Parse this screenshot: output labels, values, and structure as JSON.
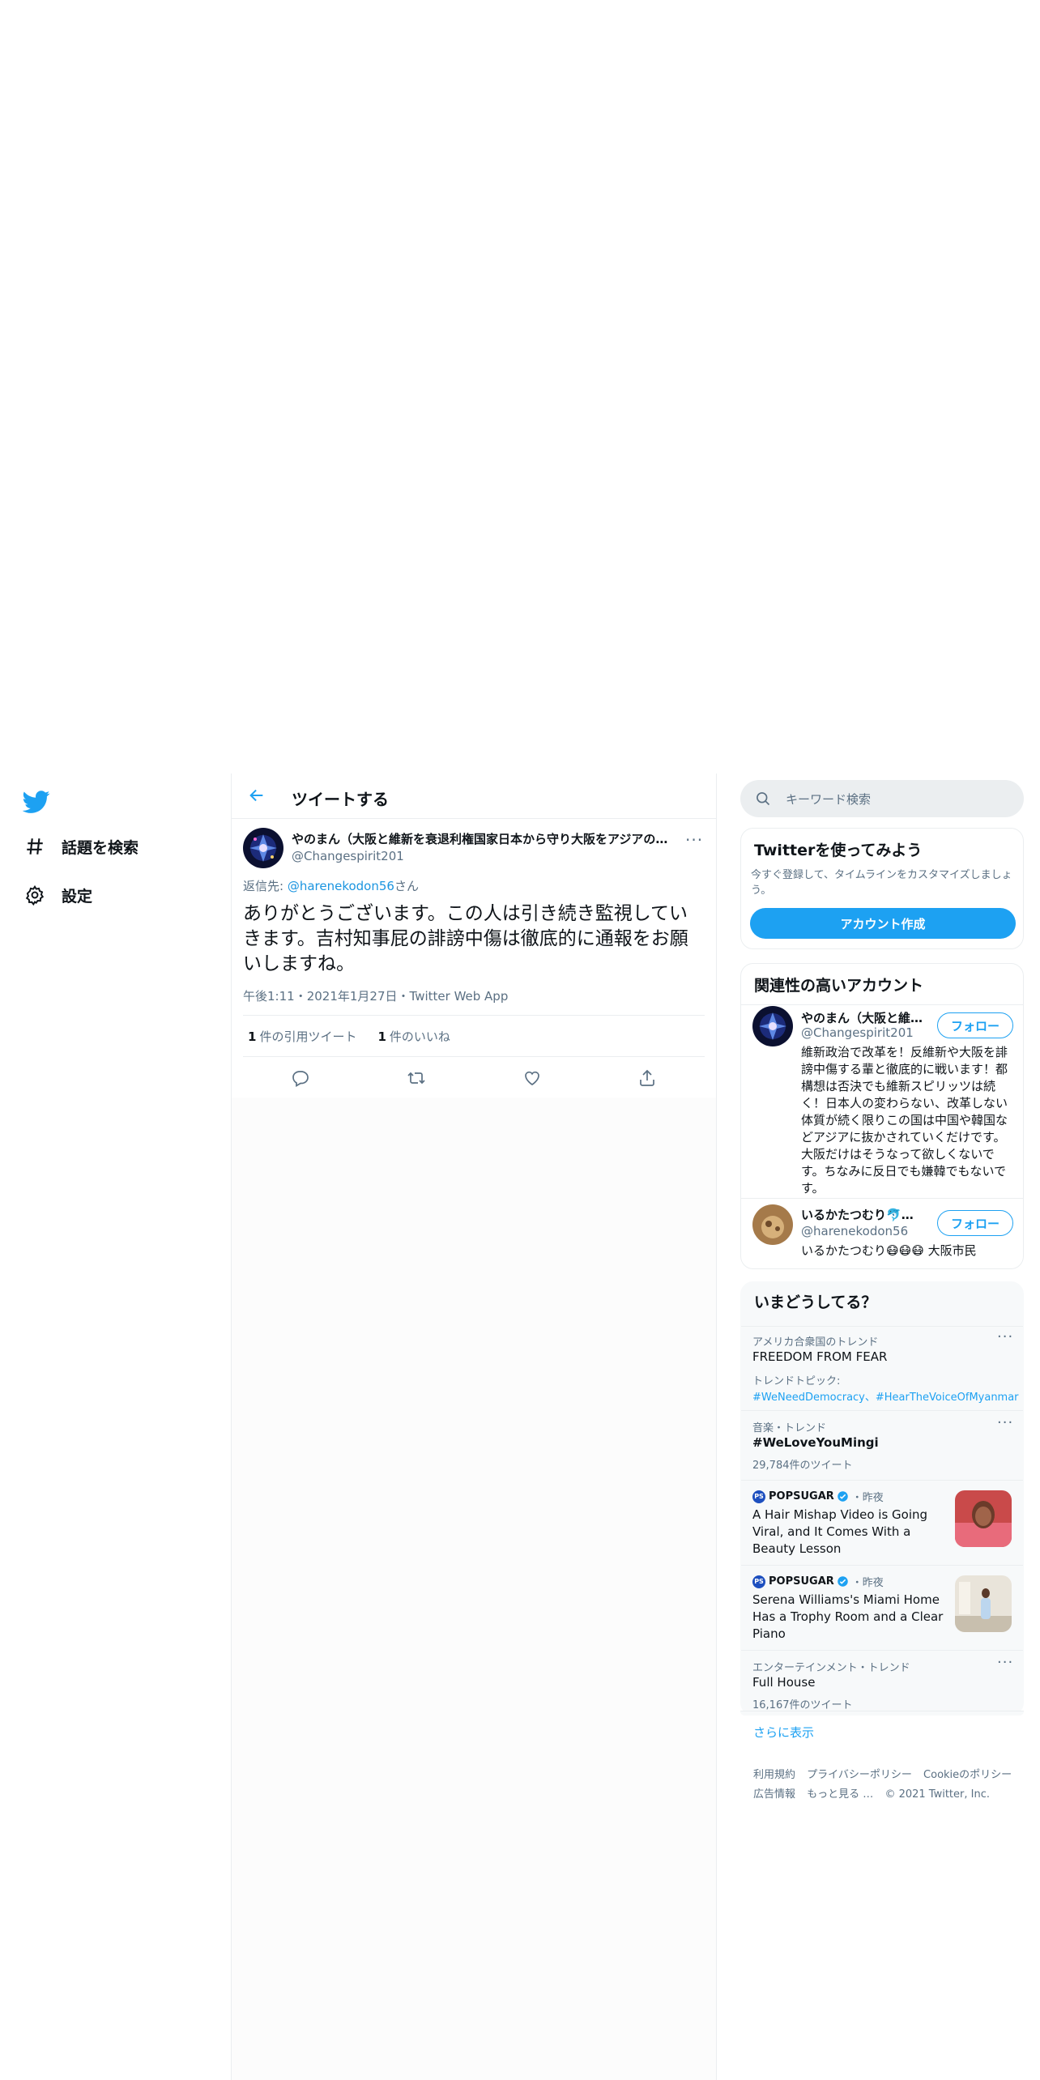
{
  "nav": {
    "logo_icon": "twitter-bird-icon",
    "items": [
      {
        "icon": "hashtag-icon",
        "label": "話題を検索"
      },
      {
        "icon": "gear-icon",
        "label": "設定"
      }
    ]
  },
  "header": {
    "back_icon": "arrow-left-icon",
    "title": "ツイートする"
  },
  "tweet": {
    "author_name": "やのまん（大阪と維新を衰退利権国家日本から守り大阪をアジアの…",
    "author_handle": "@Changespirit201",
    "more_icon": "more-icon",
    "reply_prefix": "返信先: ",
    "reply_handle": "@harenekodon56",
    "reply_suffix": "さん",
    "text": "ありがとうございます。この人は引き続き監視していきます。吉村知事屁の誹謗中傷は徹底的に通報をお願いしますね。",
    "time": "午後1:11",
    "date": "2021年1月27日",
    "source": "Twitter Web App",
    "sep": "・",
    "quote_count": "1",
    "quote_label": "件の引用ツイート",
    "like_count": "1",
    "like_label": "件のいいね",
    "actions": [
      "reply-icon",
      "retweet-icon",
      "like-icon",
      "share-icon"
    ]
  },
  "search": {
    "placeholder": "キーワード検索",
    "icon": "search-icon"
  },
  "signup": {
    "title": "Twitterを使ってみよう",
    "desc": "今すぐ登録して、タイムラインをカスタマイズしましょう。",
    "button": "アカウント作成"
  },
  "related": {
    "title": "関連性の高いアカウント",
    "accounts": [
      {
        "name": "やのまん（大阪と維…",
        "handle": "@Changespirit201",
        "follow": "フォロー",
        "bio": "維新政治で改革を！反維新や大阪を誹謗中傷する輩と徹底的に戦います！都構想は否決でも維新スピリッツは続く！日本人の変わらない、改革しない体質が続く限りこの国は中国や韓国などアジアに抜かされていくだけです。大阪だけはそうなって欲しくないです。ちなみに反日でも嫌韓でもないです。"
      },
      {
        "name": "いるかたつむり🐬🐌🐮",
        "handle": "@harenekodon56",
        "follow": "フォロー",
        "bio": "いるかたつむり😷😷😷 大阪市民"
      }
    ]
  },
  "trends": {
    "title": "いまどうしてる？",
    "items": [
      {
        "context": "アメリカ合衆国のトレンド",
        "title": "FREEDOM FROM FEAR",
        "topic_label": "トレンドトピック:",
        "topics": "#WeNeedDemocracy、#HearTheVoiceOfMyanmar"
      },
      {
        "context": "音楽・トレンド",
        "title": "#WeLoveYouMingi",
        "count": "29,784件のツイート"
      },
      {
        "source": "POPSUGAR",
        "time": "・昨夜",
        "title": "A Hair Mishap Video is Going Viral, and It Comes With a Beauty Lesson"
      },
      {
        "source": "POPSUGAR",
        "time": "・昨夜",
        "title": "Serena Williams's Miami Home Has a Trophy Room and a Clear Piano"
      },
      {
        "context": "エンターテインメント・トレンド",
        "title": "Full House",
        "count": "16,167件のツイート"
      }
    ],
    "show_more": "さらに表示"
  },
  "footer": {
    "links": [
      "利用規約",
      "プライバシーポリシー",
      "Cookieのポリシー",
      "広告情報",
      "もっと見る …",
      "© 2021 Twitter, Inc."
    ]
  },
  "colors": {
    "accent": "#1da1f2",
    "text": "#0f1419",
    "secondary": "#5b7083",
    "border": "#ebeef0"
  }
}
